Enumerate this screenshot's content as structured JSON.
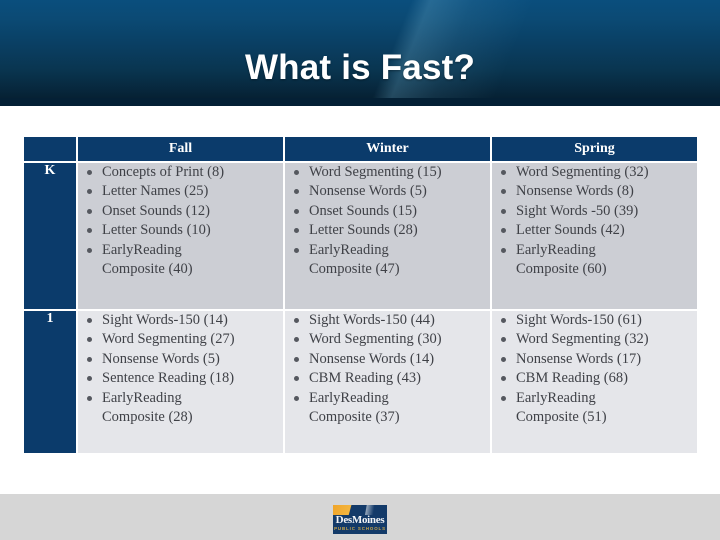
{
  "slide": {
    "title": "What is Fast?",
    "banner_color": "#0a4e7d",
    "accent_color": "#0b3b6b"
  },
  "table": {
    "corner_header": "",
    "column_headers": [
      "Fall",
      "Winter",
      "Spring"
    ],
    "rows": [
      {
        "grade": "K",
        "cells": [
          {
            "term": "Fall",
            "items": [
              "Concepts of Print (8)",
              "Letter Names (25)",
              "Onset Sounds (12)",
              "Letter Sounds (10)",
              "EarlyReading\nComposite (40)"
            ]
          },
          {
            "term": "Winter",
            "items": [
              "Word Segmenting (15)",
              "Nonsense Words (5)",
              "Onset Sounds (15)",
              "Letter Sounds (28)",
              "EarlyReading\nComposite (47)"
            ]
          },
          {
            "term": "Spring",
            "items": [
              "Word Segmenting (32)",
              "Nonsense Words  (8)",
              "Sight Words -50 (39)",
              "Letter Sounds (42)",
              "EarlyReading\nComposite (60)"
            ]
          }
        ]
      },
      {
        "grade": "1",
        "cells": [
          {
            "term": "Fall",
            "items": [
              "Sight Words-150 (14)",
              "Word Segmenting (27)",
              "Nonsense Words (5)",
              "Sentence Reading (18)",
              "EarlyReading\nComposite (28)"
            ]
          },
          {
            "term": "Winter",
            "items": [
              "Sight Words-150 (44)",
              "Word Segmenting (30)",
              "Nonsense Words (14)",
              "CBM Reading (43)",
              "EarlyReading\nComposite (37)"
            ]
          },
          {
            "term": "Spring",
            "items": [
              "Sight Words-150 (61)",
              "Word Segmenting (32)",
              "Nonsense Words (17)",
              "CBM Reading (68)",
              "EarlyReading\nComposite (51)"
            ]
          }
        ]
      }
    ]
  },
  "footer": {
    "logo_name": "DesMoines",
    "logo_subtitle": "PUBLIC SCHOOLS"
  }
}
